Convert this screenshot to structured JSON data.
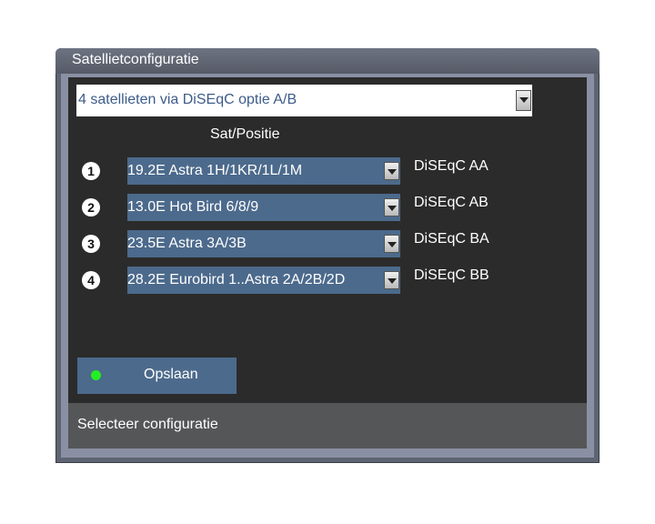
{
  "dialog": {
    "title": "Satellietconfiguratie"
  },
  "config": {
    "selected": "4 satellieten via DiSEqC optie A/B"
  },
  "column_header": "Sat/Positie",
  "satellites": [
    {
      "number": "1",
      "name": "19.2E Astra 1H/1KR/1L/1M",
      "diseqc": "DiSEqC AA"
    },
    {
      "number": "2",
      "name": "13.0E Hot Bird 6/8/9",
      "diseqc": "DiSEqC AB"
    },
    {
      "number": "3",
      "name": "23.5E Astra 3A/3B",
      "diseqc": "DiSEqC BA"
    },
    {
      "number": "4",
      "name": "28.2E Eurobird 1..Astra 2A/2B/2D",
      "diseqc": "DiSEqC BB"
    }
  ],
  "save_button": {
    "label": "Opslaan",
    "indicator_color": "#22ee22"
  },
  "status": {
    "text": "Selecteer configuratie"
  },
  "colors": {
    "selection_blue": "#4c6a8c",
    "content_bg": "#2b2b2b"
  },
  "icons": {
    "dropdown": "chevron-down-icon",
    "save_indicator": "green-dot-icon"
  }
}
